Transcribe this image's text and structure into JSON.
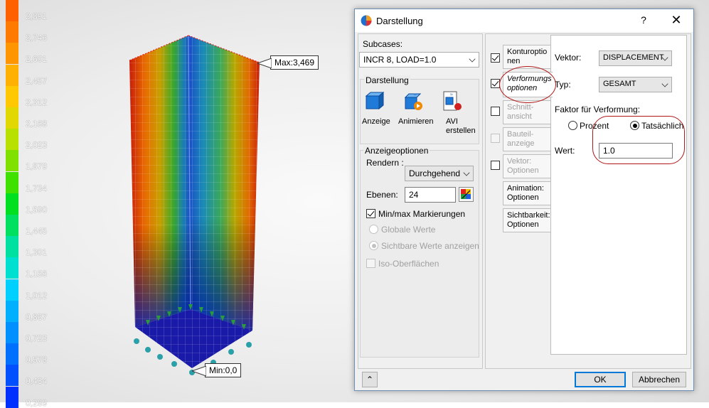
{
  "viewport": {
    "legend": {
      "labels": [
        "2,891",
        "2,746",
        "2,601",
        "2,457",
        "2,312",
        "2,168",
        "2,023",
        "1,879",
        "1,734",
        "1,590",
        "1,445",
        "1,301",
        "1,156",
        "1,012",
        "0,867",
        "0,723",
        "0,578",
        "0,434",
        "0,289"
      ],
      "colors": [
        "#ff6000",
        "#ff7a00",
        "#ff9600",
        "#ffb000",
        "#ffc800",
        "#e0d800",
        "#b8e000",
        "#80e000",
        "#40e000",
        "#00e020",
        "#00e060",
        "#00e0a0",
        "#00e0d0",
        "#00d0ff",
        "#00b0ff",
        "#0090ff",
        "#0070ff",
        "#0050ff",
        "#0030ff"
      ]
    },
    "max_label": "Max:3,469",
    "min_label": "Min:0,0"
  },
  "dialog": {
    "title": "Darstellung",
    "help": "?",
    "close": "✕",
    "subcases_label": "Subcases:",
    "subcase_value": "INCR 8, LOAD=1.0",
    "darstellung_group": "Darstellung",
    "buttons": {
      "anzeige": "Anzeige",
      "animieren": "Animieren",
      "avi": "AVI erstellen"
    },
    "anzeigeoptionen_group": "Anzeigeoptionen",
    "rendern_label": "Rendern :",
    "rendern_value": "Durchgehend",
    "ebenen_label": "Ebenen:",
    "ebenen_value": "24",
    "minmax_label": "Min/max Markierungen",
    "globale_label": "Globale Werte",
    "sichtbare_label": "Sichtbare Werte anzeigen",
    "iso_label": "Iso-Oberflächen",
    "tabs": [
      {
        "line1": "Konturoptio",
        "line2": "nen",
        "checked": true,
        "disabled": false,
        "italic": false
      },
      {
        "line1": "Verformungs",
        "line2": "optionen",
        "checked": true,
        "disabled": false,
        "italic": true
      },
      {
        "line1": "Schnitt-",
        "line2": "ansicht",
        "checked": false,
        "disabled": true,
        "italic": false
      },
      {
        "line1": "Bauteil-",
        "line2": "anzeige",
        "checked": false,
        "disabled": true,
        "italic": false
      },
      {
        "line1": "Vektor:",
        "line2": "Optionen",
        "checked": false,
        "disabled": true,
        "italic": false
      },
      {
        "line1": "Animation:",
        "line2": "Optionen",
        "checked": null,
        "disabled": false,
        "italic": false
      },
      {
        "line1": "Sichtbarkeit:",
        "line2": "Optionen",
        "checked": null,
        "disabled": false,
        "italic": false
      }
    ],
    "vektor_label": "Vektor:",
    "vektor_value": "DISPLACEMENT",
    "typ_label": "Typ:",
    "typ_value": "GESAMT",
    "faktor_label": "Faktor für Verformung:",
    "prozent_label": "Prozent",
    "tatsaechlich_label": "Tatsächlich",
    "wert_label": "Wert:",
    "wert_value": "1.0",
    "ok_label": "OK",
    "abbrechen_label": "Abbrechen",
    "collapse_glyph": "⌃"
  }
}
